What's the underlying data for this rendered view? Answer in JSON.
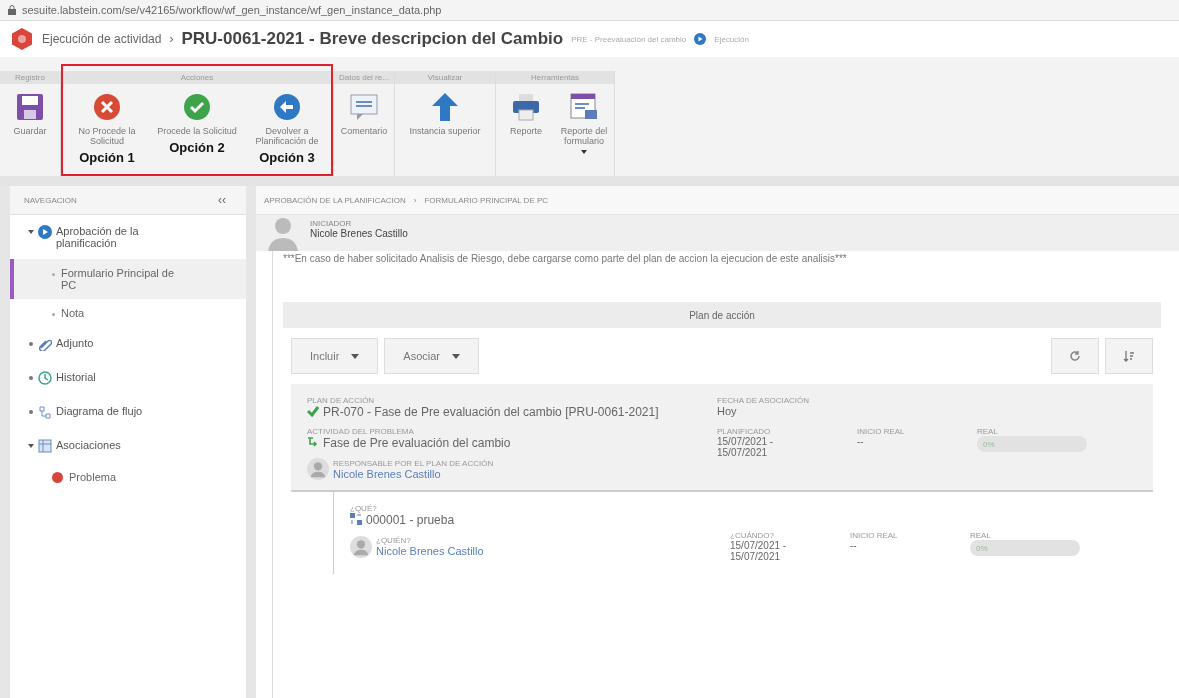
{
  "address_bar": {
    "url": "sesuite.labstein.com/se/v42165/workflow/wf_gen_instance/wf_gen_instance_data.php"
  },
  "title_bar": {
    "section": "Ejecución de actividad",
    "separator": "›",
    "title": "PRU-0061-2021 - Breve descripcion del Cambio",
    "activity": "PRE - Preevaluación del cambio",
    "status": "Ejecución"
  },
  "ribbon": {
    "groups": [
      {
        "label": "Registro",
        "highlighted": false,
        "buttons": [
          {
            "kind": "save",
            "label": "Guardar",
            "dropdown": false
          }
        ]
      },
      {
        "label": "Acciones",
        "highlighted": true,
        "buttons": [
          {
            "kind": "reject",
            "label": "No Procede la Solicitud",
            "note": "Opción 1",
            "dropdown": false
          },
          {
            "kind": "approve",
            "label": "Procede la Solicitud",
            "note": "Opción 2",
            "dropdown": false
          },
          {
            "kind": "return",
            "label": "Devolver a Planificación de",
            "note": "Opción 3",
            "dropdown": false
          }
        ]
      },
      {
        "label": "Datos del re...",
        "highlighted": false,
        "buttons": [
          {
            "kind": "comment",
            "label": "Comentario",
            "dropdown": false
          }
        ]
      },
      {
        "label": "Visualizar",
        "highlighted": false,
        "buttons": [
          {
            "kind": "up",
            "label": "Instancia superior",
            "dropdown": false
          }
        ]
      },
      {
        "label": "Herramientas",
        "highlighted": false,
        "buttons": [
          {
            "kind": "print",
            "label": "Reporte",
            "dropdown": false
          },
          {
            "kind": "form",
            "label": "Reporte del formulario",
            "dropdown": true
          }
        ]
      }
    ]
  },
  "sidebar": {
    "title": "NAVEGACION",
    "collapse": "‹‹",
    "items": [
      {
        "kind": "play",
        "label": "Aprobación de la planificación",
        "expanded": true,
        "selected": false,
        "children": [
          {
            "label": "Formulario Principal de PC",
            "selected": true
          },
          {
            "label": "Nota",
            "selected": false
          }
        ]
      },
      {
        "kind": "clip",
        "label": "Adjunto",
        "expanded": false,
        "selected": false
      },
      {
        "kind": "history",
        "label": "Historial",
        "expanded": false,
        "selected": false
      },
      {
        "kind": "flow",
        "label": "Diagrama de flujo",
        "expanded": false,
        "selected": false
      },
      {
        "kind": "assoc",
        "label": "Asociaciones",
        "expanded": true,
        "selected": false,
        "children": [
          {
            "label": "Problema",
            "selected": false,
            "color": "#d9453b"
          }
        ]
      }
    ]
  },
  "breadcrumb": [
    "APROBACIÓN DE LA PLANIFICACION",
    "FORMULARIO PRINCIPAL DE PC"
  ],
  "breadcrumb_separator": "›",
  "initiator": {
    "label": "INICIADOR",
    "name": "Nicole Brenes Castillo"
  },
  "note": "***En caso de haber solicitado Analisis de Riesgo, debe cargarse como parte del plan de accion la ejecucion de este analisis***",
  "action_plan": {
    "title": "Plan de acción",
    "menus": [
      "Incluir",
      "Asociar"
    ],
    "plan": {
      "plan_label": "PLAN DE ACCIÓN",
      "plan_value": "PR-070 - Fase de Pre evaluación del cambio [PRU-0061-2021]",
      "date_label": "FECHA DE ASOCIACIÓN",
      "date_value": "Hoy",
      "activity_label": "ACTIVIDAD DEL PROBLEMA",
      "activity_value": "Fase de Pre evaluación del cambio",
      "planned_label": "PLANIFICADO",
      "planned_value": "15/07/2021 - 15/07/2021",
      "start_label": "INICIO REAL",
      "start_value": "--",
      "real_label": "REAL",
      "real_value": "0%",
      "owner_label": "RESPONSABLE POR EL PLAN DE ACCIÓN",
      "owner_name": "Nicole Brenes Castillo"
    },
    "task": {
      "what_label": "¿QUÉ?",
      "what_value": "000001 - prueba",
      "who_label": "¿QUIÉN?",
      "who_name": "Nicole Brenes Castillo",
      "when_label": "¿CUÁNDO?",
      "when_value": "15/07/2021 - 15/07/2021",
      "start_label": "INICIO REAL",
      "start_value": "--",
      "real_label": "REAL",
      "real_value": "0%"
    }
  }
}
